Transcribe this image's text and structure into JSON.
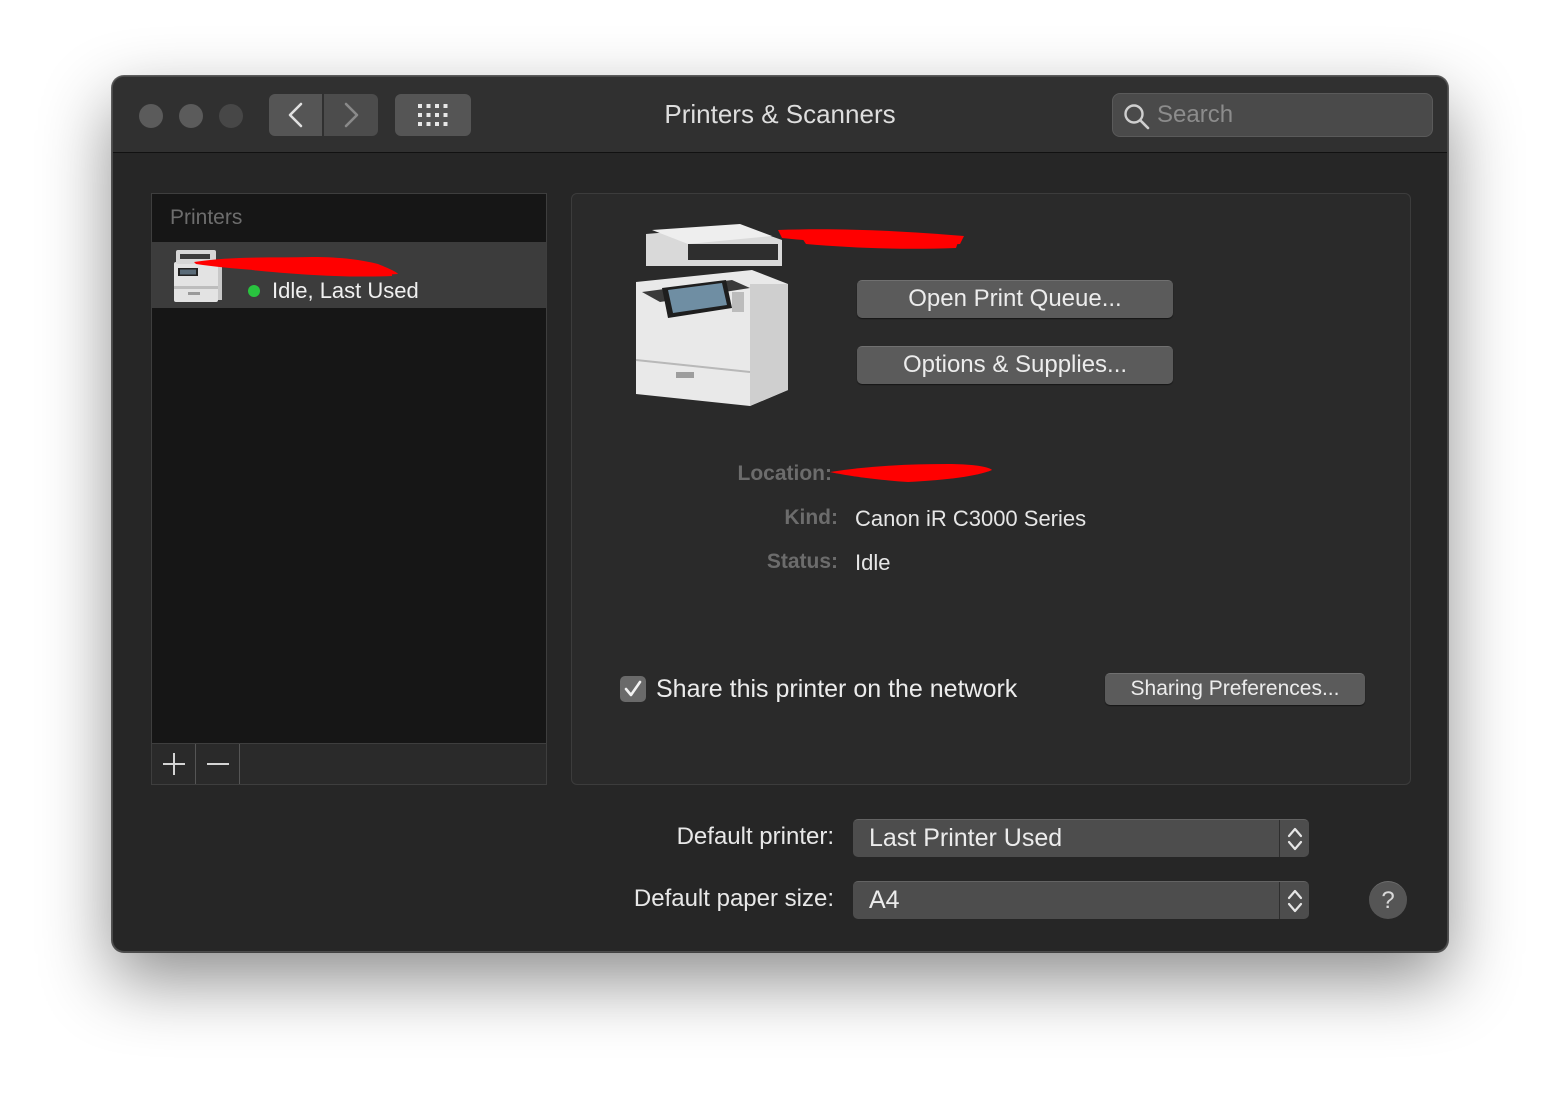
{
  "window": {
    "title": "Printers & Scanners"
  },
  "toolbar": {
    "back_icon": "chevron-left-icon",
    "forward_icon": "chevron-right-icon",
    "grid_icon": "grid-icon",
    "search_placeholder": "Search"
  },
  "sidebar": {
    "header": "Printers",
    "printers": [
      {
        "name": "",
        "status": "Idle, Last Used",
        "status_color": "#29c33f",
        "selected": true
      }
    ],
    "add_label": "+",
    "remove_label": "—"
  },
  "detail": {
    "printer_name": "",
    "open_queue_label": "Open Print Queue...",
    "options_label": "Options & Supplies...",
    "location_label": "Location:",
    "location_value": "",
    "kind_label": "Kind:",
    "kind_value": "Canon iR C3000 Series",
    "status_label": "Status:",
    "status_value": "Idle",
    "share_checked": true,
    "share_label": "Share this printer on the network",
    "sharing_prefs_label": "Sharing Preferences..."
  },
  "defaults": {
    "printer_label": "Default printer:",
    "printer_value": "Last Printer Used",
    "paper_label": "Default paper size:",
    "paper_value": "A4"
  },
  "help_label": "?",
  "colors": {
    "redaction": "#ff0000",
    "window_bg": "#262626",
    "accent_green": "#29c33f"
  }
}
